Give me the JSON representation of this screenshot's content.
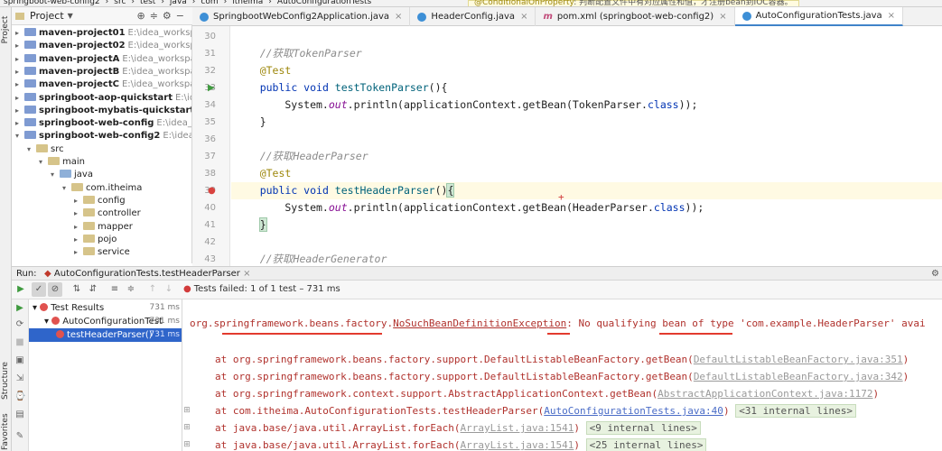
{
  "breadcrumb": [
    "springboot-web-config2",
    "src",
    "test",
    "java",
    "com",
    "itheima",
    "AutoConfigurationTests"
  ],
  "hint": {
    "label": "@ConditionalOnProperty",
    "text": ": 判断配置文件中有对应属性和值，才注册bean到IOC容器。"
  },
  "left_strip": {
    "project": "Project",
    "structure": "Structure",
    "favorites": "Favorites"
  },
  "project_panel": {
    "title": "Project",
    "icons": [
      "target-icon",
      "collapse-icon",
      "gear-icon",
      "minus-icon"
    ]
  },
  "tree": [
    {
      "name": "maven-project01",
      "path": "E:\\idea_workspace\\ith",
      "level": 0,
      "expanded": false,
      "bold": true,
      "kind": "module"
    },
    {
      "name": "maven-project02",
      "path": "E:\\idea_workspace\\ith",
      "level": 0,
      "expanded": false,
      "bold": true,
      "kind": "module"
    },
    {
      "name": "maven-projectA",
      "path": "E:\\idea_workspace\\ith",
      "level": 0,
      "expanded": false,
      "bold": true,
      "kind": "module"
    },
    {
      "name": "maven-projectB",
      "path": "E:\\idea_workspace\\ith",
      "level": 0,
      "expanded": false,
      "bold": true,
      "kind": "module"
    },
    {
      "name": "maven-projectC",
      "path": "E:\\idea_workspace\\ith",
      "level": 0,
      "expanded": false,
      "bold": true,
      "kind": "module"
    },
    {
      "name": "springboot-aop-quickstart",
      "path": "E:\\idea_wo",
      "level": 0,
      "expanded": false,
      "bold": true,
      "kind": "module"
    },
    {
      "name": "springboot-mybatis-quickstart",
      "path": "E:\\idea",
      "level": 0,
      "expanded": false,
      "bold": true,
      "kind": "module"
    },
    {
      "name": "springboot-web-config",
      "path": "E:\\idea_worksp",
      "level": 0,
      "expanded": false,
      "bold": true,
      "kind": "module"
    },
    {
      "name": "springboot-web-config2",
      "path": "E:\\idea_works",
      "level": 0,
      "expanded": true,
      "bold": true,
      "kind": "module"
    },
    {
      "name": "src",
      "path": "",
      "level": 1,
      "expanded": true,
      "bold": false,
      "kind": "folder"
    },
    {
      "name": "main",
      "path": "",
      "level": 2,
      "expanded": true,
      "bold": false,
      "kind": "folder"
    },
    {
      "name": "java",
      "path": "",
      "level": 3,
      "expanded": true,
      "bold": false,
      "kind": "src"
    },
    {
      "name": "com.itheima",
      "path": "",
      "level": 4,
      "expanded": true,
      "bold": false,
      "kind": "folder"
    },
    {
      "name": "config",
      "path": "",
      "level": 5,
      "expanded": false,
      "bold": false,
      "kind": "folder"
    },
    {
      "name": "controller",
      "path": "",
      "level": 5,
      "expanded": false,
      "bold": false,
      "kind": "folder"
    },
    {
      "name": "mapper",
      "path": "",
      "level": 5,
      "expanded": false,
      "bold": false,
      "kind": "folder"
    },
    {
      "name": "pojo",
      "path": "",
      "level": 5,
      "expanded": false,
      "bold": false,
      "kind": "folder"
    },
    {
      "name": "service",
      "path": "",
      "level": 5,
      "expanded": false,
      "bold": false,
      "kind": "folder"
    }
  ],
  "tabs": [
    {
      "label": "SpringbootWebConfig2Application.java",
      "icon": "class-icon",
      "active": false
    },
    {
      "label": "HeaderConfig.java",
      "icon": "class-icon",
      "active": false
    },
    {
      "label": "pom.xml (springboot-web-config2)",
      "icon": "maven-icon",
      "active": false
    },
    {
      "label": "AutoConfigurationTests.java",
      "icon": "class-icon",
      "active": true
    }
  ],
  "editor": {
    "lines": [
      {
        "n": "30",
        "tokens": []
      },
      {
        "n": "31",
        "tokens": [
          {
            "t": "    //获取TokenParser",
            "c": "cm"
          }
        ]
      },
      {
        "n": "32",
        "tokens": [
          {
            "t": "    @Test",
            "c": "an"
          }
        ]
      },
      {
        "n": "33",
        "tokens": [
          {
            "t": "    ",
            "c": ""
          },
          {
            "t": "public void ",
            "c": "kw"
          },
          {
            "t": "testTokenParser",
            "c": "fn"
          },
          {
            "t": "(){",
            "c": ""
          }
        ],
        "gutter": "run"
      },
      {
        "n": "34",
        "tokens": [
          {
            "t": "        System.",
            "c": ""
          },
          {
            "t": "out",
            "c": "st"
          },
          {
            "t": ".println(applicationContext.getBean(TokenParser.",
            "c": ""
          },
          {
            "t": "class",
            "c": "kw"
          },
          {
            "t": "));",
            "c": ""
          }
        ]
      },
      {
        "n": "35",
        "tokens": [
          {
            "t": "    }",
            "c": ""
          }
        ]
      },
      {
        "n": "36",
        "tokens": []
      },
      {
        "n": "37",
        "tokens": [
          {
            "t": "    //获取HeaderParser",
            "c": "cm"
          }
        ]
      },
      {
        "n": "38",
        "tokens": [
          {
            "t": "    @Test",
            "c": "an"
          }
        ]
      },
      {
        "n": "39",
        "tokens": [
          {
            "t": "    ",
            "c": ""
          },
          {
            "t": "public void ",
            "c": "kw"
          },
          {
            "t": "testHeaderParser",
            "c": "fn"
          },
          {
            "t": "()",
            "c": ""
          },
          {
            "t": "{",
            "c": "brk"
          }
        ],
        "gutter": "fail",
        "highlight": true
      },
      {
        "n": "40",
        "tokens": [
          {
            "t": "        System.",
            "c": ""
          },
          {
            "t": "out",
            "c": "st"
          },
          {
            "t": ".println(applicationContext.getBean(HeaderParser.",
            "c": ""
          },
          {
            "t": "class",
            "c": "kw"
          },
          {
            "t": "));",
            "c": ""
          }
        ]
      },
      {
        "n": "41",
        "tokens": [
          {
            "t": "    ",
            "c": ""
          },
          {
            "t": "}",
            "c": "brk"
          }
        ]
      },
      {
        "n": "42",
        "tokens": []
      },
      {
        "n": "43",
        "tokens": [
          {
            "t": "    //获取HeaderGenerator",
            "c": "cm"
          }
        ]
      }
    ]
  },
  "run": {
    "label": "Run:",
    "config": "AutoConfigurationTests.testHeaderParser",
    "status": "Tests failed: 1 of 1 test – 731 ms"
  },
  "results": [
    {
      "label": "Test Results",
      "time": "731 ms",
      "level": 0,
      "selected": false
    },
    {
      "label": "AutoConfigurationTest",
      "time": "731 ms",
      "level": 1,
      "selected": false
    },
    {
      "label": "testHeaderParser()",
      "time": "731 ms",
      "level": 2,
      "selected": true
    }
  ],
  "console": {
    "exception_pkg": "org.springframework.beans.factory.",
    "exception_name": "NoSuchBeanDefinitionException",
    "exception_mid": ": No qualifying bean of ",
    "exception_type_word": "type",
    "exception_tail_a": " 'com.example.",
    "exception_bean": "HeaderParser",
    "exception_tail_b": "' avai",
    "frames": [
      {
        "text": "at org.springframework.beans.factory.support.DefaultListableBeanFactory.getBean(",
        "link": "DefaultListableBeanFactory.java:351",
        "close": ")",
        "lib": true,
        "fold": ""
      },
      {
        "text": "at org.springframework.beans.factory.support.DefaultListableBeanFactory.getBean(",
        "link": "DefaultListableBeanFactory.java:342",
        "close": ")",
        "lib": true,
        "fold": ""
      },
      {
        "text": "at org.springframework.context.support.AbstractApplicationContext.getBean(",
        "link": "AbstractApplicationContext.java:1172",
        "close": ")",
        "lib": true,
        "fold": ""
      },
      {
        "text": "at com.itheima.AutoConfigurationTests.testHeaderParser(",
        "link": "AutoConfigurationTests.java:40",
        "close": ")",
        "lib": false,
        "fold": "<31 internal lines>"
      },
      {
        "text": "at java.base/java.util.ArrayList.forEach(",
        "link": "ArrayList.java:1541",
        "close": ")",
        "lib": true,
        "fold": "<9 internal lines>"
      },
      {
        "text": "at java.base/java.util.ArrayList.forEach(",
        "link": "ArrayList.java:1541",
        "close": ")",
        "lib": true,
        "fold": "<25 internal lines>"
      }
    ]
  }
}
